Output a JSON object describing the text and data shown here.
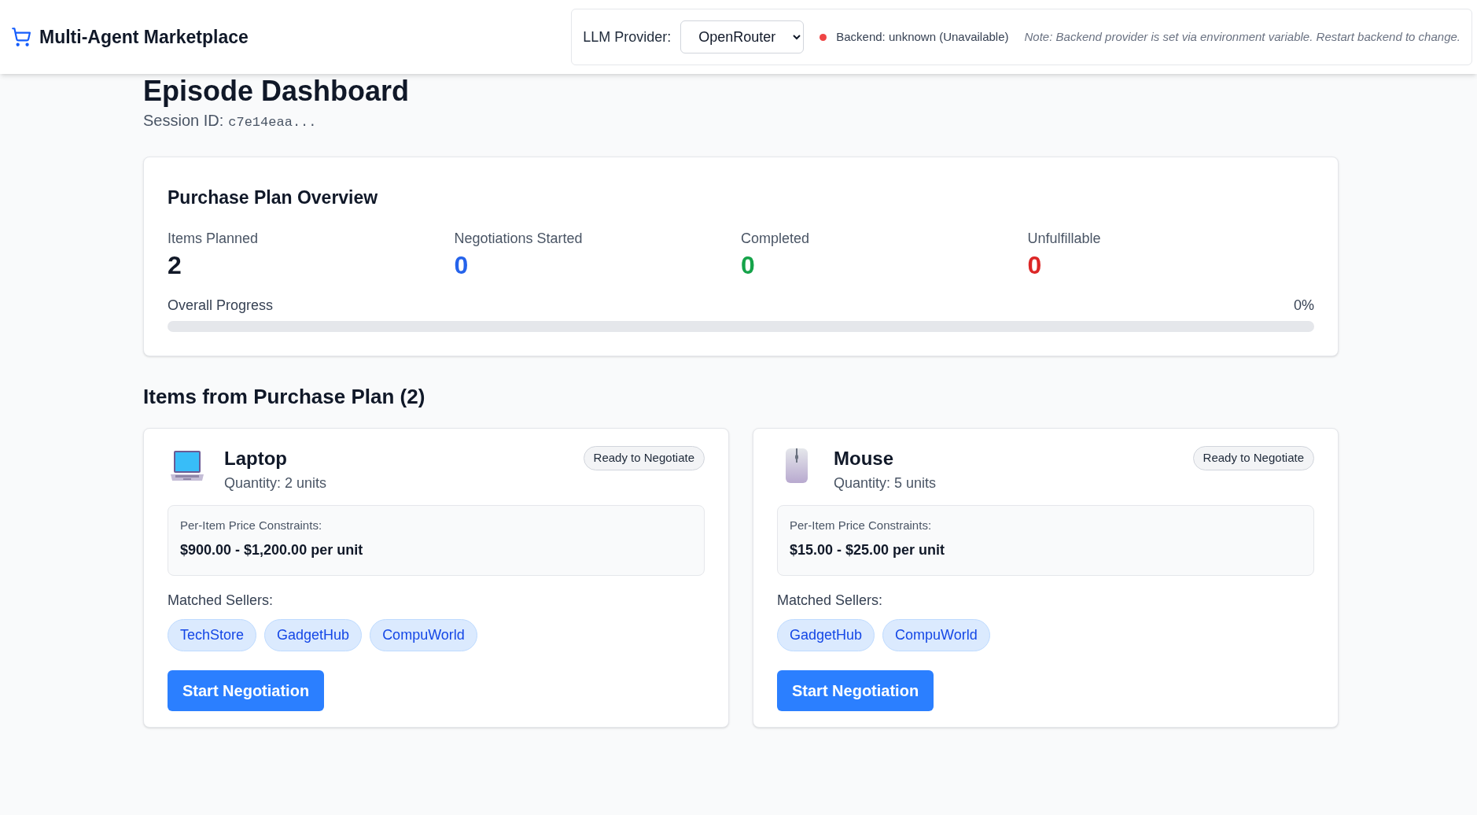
{
  "header": {
    "brand": "Multi-Agent Marketplace",
    "provider_label": "LLM Provider:",
    "provider_value": "OpenRouter",
    "backend": {
      "text": "Backend: unknown (Unavailable)",
      "color": "#ef4444"
    },
    "note": "Note: Backend provider is set via environment variable. Restart backend to change."
  },
  "page": {
    "title": "Episode Dashboard",
    "session_label": "Session ID:",
    "session_id": "c7e14eaa..."
  },
  "overview": {
    "title": "Purchase Plan Overview",
    "stats": [
      {
        "label": "Items Planned",
        "value": "2",
        "color": "#111827"
      },
      {
        "label": "Negotiations Started",
        "value": "0",
        "color": "#2563eb"
      },
      {
        "label": "Completed",
        "value": "0",
        "color": "#16a34a"
      },
      {
        "label": "Unfulfillable",
        "value": "0",
        "color": "#dc2626"
      }
    ],
    "progress": {
      "label": "Overall Progress",
      "reading": "0%",
      "level": 0
    }
  },
  "items_heading": "Items from Purchase Plan (2)",
  "items": [
    {
      "kind": "laptop",
      "name": "Laptop",
      "quantity": "Quantity: 2 units",
      "status": "Ready to Negotiate",
      "price_label": "Per-Item Price Constraints:",
      "price": "$900.00 - $1,200.00 per unit",
      "sellers_label": "Matched Sellers:",
      "sellers": [
        "TechStore",
        "GadgetHub",
        "CompuWorld"
      ],
      "button": "Start Negotiation"
    },
    {
      "kind": "mouse",
      "name": "Mouse",
      "quantity": "Quantity: 5 units",
      "status": "Ready to Negotiate",
      "price_label": "Per-Item Price Constraints:",
      "price": "$15.00 - $25.00 per unit",
      "sellers_label": "Matched Sellers:",
      "sellers": [
        "GadgetHub",
        "CompuWorld"
      ],
      "button": "Start Negotiation"
    }
  ]
}
